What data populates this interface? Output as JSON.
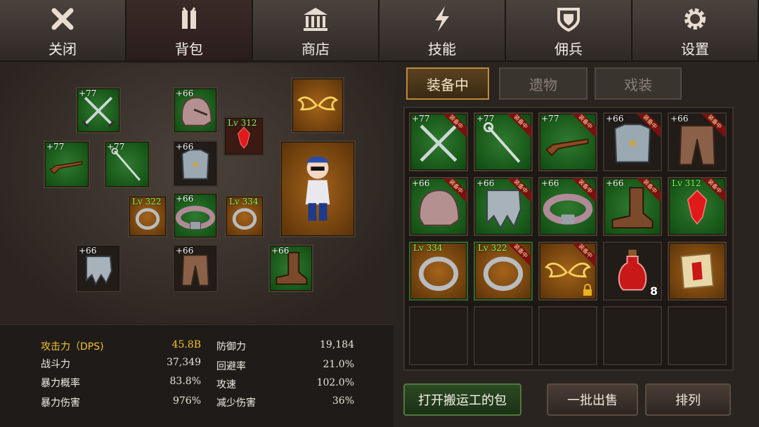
{
  "nav": {
    "tabs": [
      {
        "label": "关闭",
        "icon": "close-icon"
      },
      {
        "label": "背包",
        "icon": "backpack-icon"
      },
      {
        "label": "商店",
        "icon": "shop-icon"
      },
      {
        "label": "技能",
        "icon": "skill-icon"
      },
      {
        "label": "佣兵",
        "icon": "shield-icon"
      },
      {
        "label": "设置",
        "icon": "gear-icon"
      }
    ],
    "active_index": 1
  },
  "equipment_slots": [
    {
      "badge": "+77",
      "icon": "crossed-swords-icon"
    },
    {
      "badge": "+66",
      "icon": "helmet-icon"
    },
    {
      "badge": "Lv 312",
      "icon": "red-gem-icon"
    },
    {
      "badge": "",
      "icon": "wings-icon"
    },
    {
      "badge": "+77",
      "icon": "rifle-icon"
    },
    {
      "badge": "+77",
      "icon": "staff-icon"
    },
    {
      "badge": "+66",
      "icon": "armor-icon"
    },
    {
      "badge": "Lv 322",
      "icon": "ring-icon"
    },
    {
      "badge": "+66",
      "icon": "belt-icon"
    },
    {
      "badge": "Lv 334",
      "icon": "ring-icon"
    },
    {
      "badge": "+66",
      "icon": "gauntlet-icon"
    },
    {
      "badge": "+66",
      "icon": "pants-icon"
    },
    {
      "badge": "+66",
      "icon": "boots-icon"
    }
  ],
  "character": {
    "icon": "character-avatar"
  },
  "stats": {
    "left": [
      {
        "label": "攻击力（DPS)",
        "value": "45.8B"
      },
      {
        "label": "战斗力",
        "value": "37,349"
      },
      {
        "label": "暴力概率",
        "value": "83.8%"
      },
      {
        "label": "暴力伤害",
        "value": "976%"
      }
    ],
    "right": [
      {
        "label": "防御力",
        "value": "19,184"
      },
      {
        "label": "回避率",
        "value": "21.0%"
      },
      {
        "label": "攻速",
        "value": "102.0%"
      },
      {
        "label": "减少伤害",
        "value": "36%"
      }
    ]
  },
  "subtabs": [
    "装备中",
    "遗物",
    "戏装"
  ],
  "inventory": {
    "equipped_tag": "装备中",
    "items": [
      {
        "badge": "+77",
        "icon": "crossed-swords-icon",
        "equipped": true
      },
      {
        "badge": "+77",
        "icon": "staff-icon",
        "equipped": true
      },
      {
        "badge": "+77",
        "icon": "rifle-icon",
        "equipped": true
      },
      {
        "badge": "+66",
        "icon": "armor-icon",
        "equipped": true
      },
      {
        "badge": "+66",
        "icon": "pants-icon",
        "equipped": true
      },
      {
        "badge": "+66",
        "icon": "helmet-icon",
        "equipped": true
      },
      {
        "badge": "+66",
        "icon": "gauntlet-icon",
        "equipped": true
      },
      {
        "badge": "+66",
        "icon": "belt-icon",
        "equipped": true
      },
      {
        "badge": "+66",
        "icon": "boots-icon",
        "equipped": true
      },
      {
        "badge": "Lv 312",
        "icon": "red-gem-icon",
        "equipped": true
      },
      {
        "badge": "Lv 334",
        "icon": "ring-icon",
        "equipped": true
      },
      {
        "badge": "Lv 322",
        "icon": "ring-icon",
        "equipped": true
      },
      {
        "badge": "",
        "icon": "wings-icon",
        "equipped": true,
        "locked": true
      },
      {
        "badge": "",
        "icon": "potion-icon",
        "count": "8"
      },
      {
        "badge": "",
        "icon": "scroll-icon"
      }
    ]
  },
  "buttons": {
    "open_bag": "打开搬运工的包",
    "bulk_sell": "一批出售",
    "sort": "排列"
  }
}
